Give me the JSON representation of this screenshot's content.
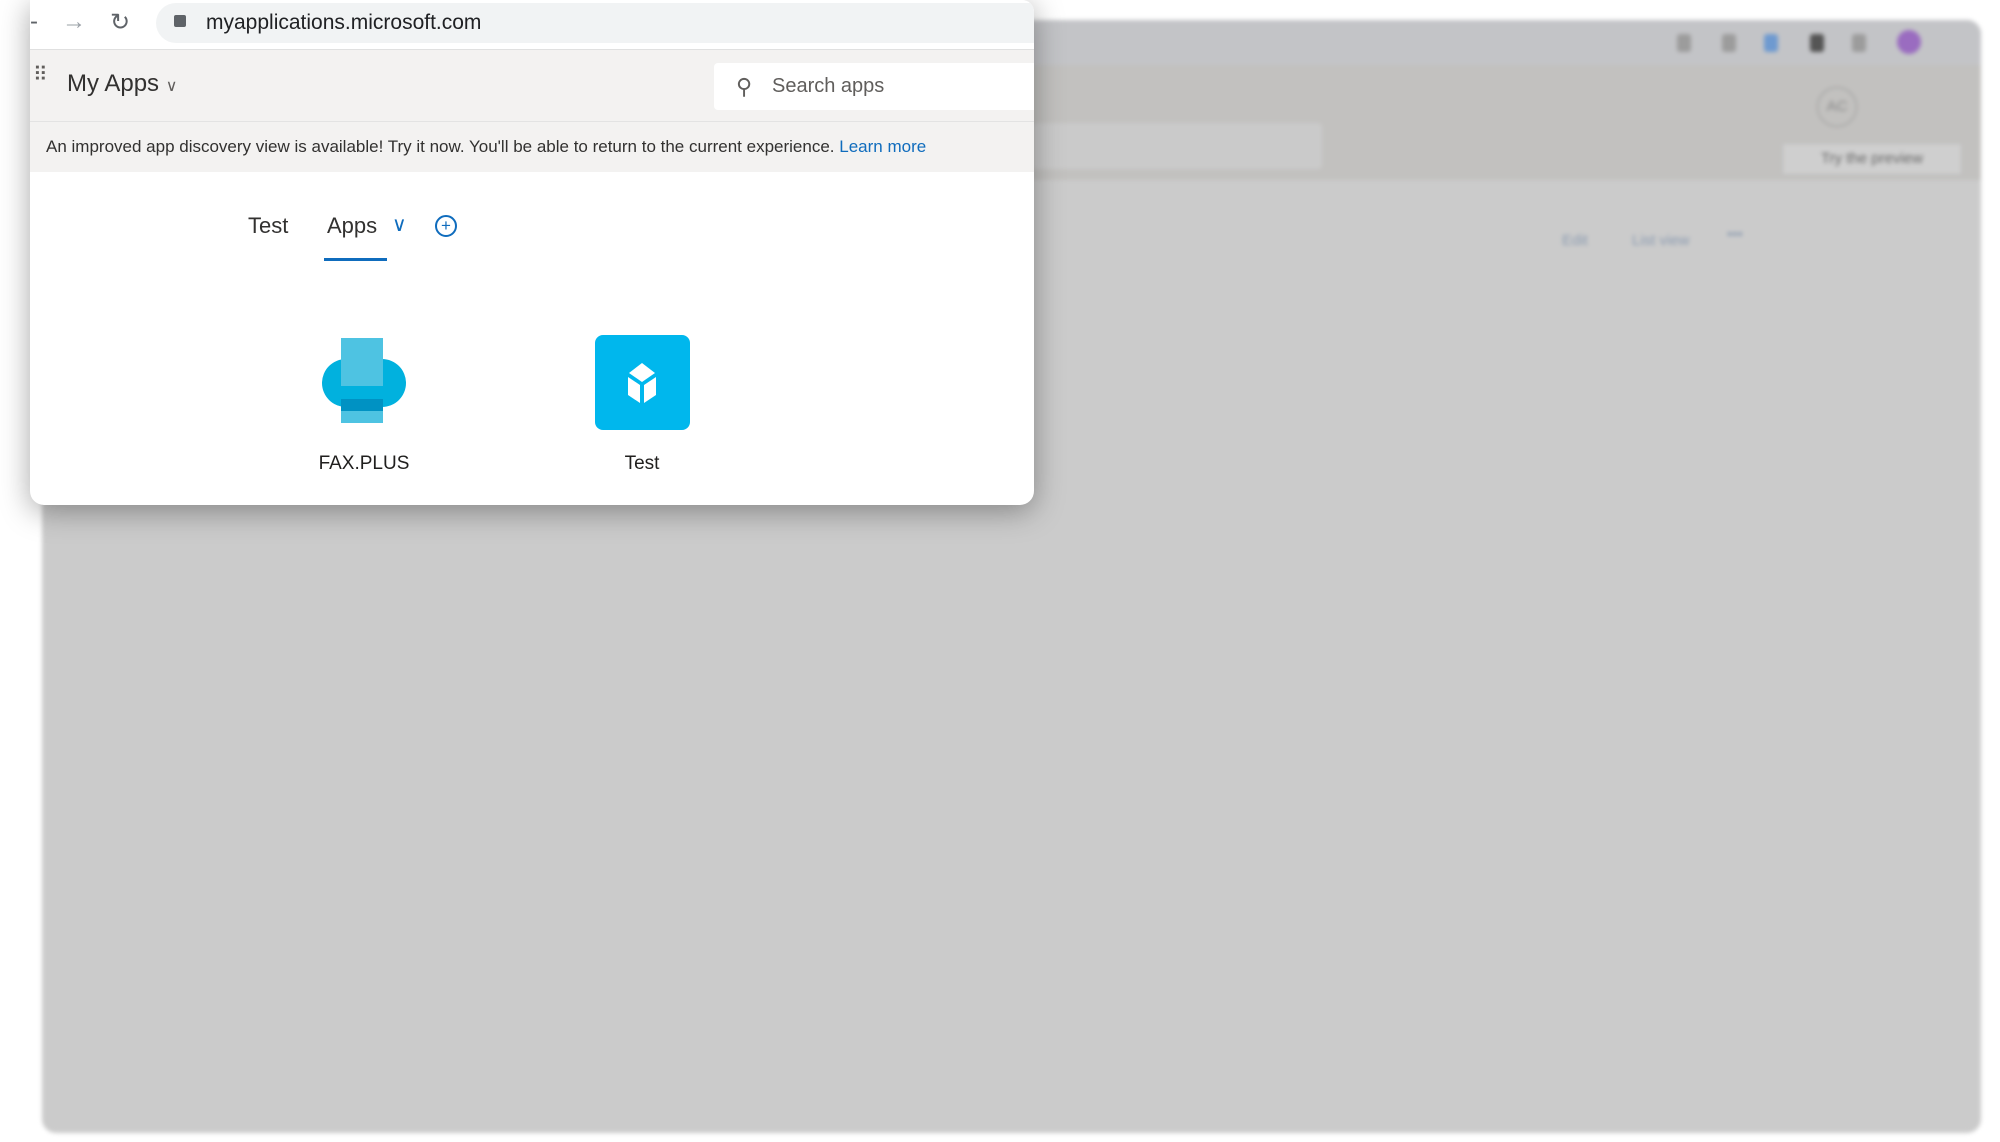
{
  "browser": {
    "url": "myapplications.microsoft.com"
  },
  "header": {
    "title": "My Apps",
    "search_placeholder": "Search apps"
  },
  "banner": {
    "text": "An improved app discovery view is available! Try it now. You'll be able to return to the current experience.",
    "link": "Learn more"
  },
  "tabs": [
    {
      "label": "Test",
      "active": false
    },
    {
      "label": "Apps",
      "active": true
    }
  ],
  "apps": [
    {
      "name": "FAX.PLUS",
      "icon": "fax-plus-logo"
    },
    {
      "name": "Test",
      "icon": "cube-icon",
      "color": "#00b7ed"
    }
  ],
  "background_window": {
    "try_preview": "Try the preview",
    "edit": "Edit",
    "list_view": "List view",
    "avatar": "AC"
  },
  "colors": {
    "accent": "#0f6cbd"
  }
}
